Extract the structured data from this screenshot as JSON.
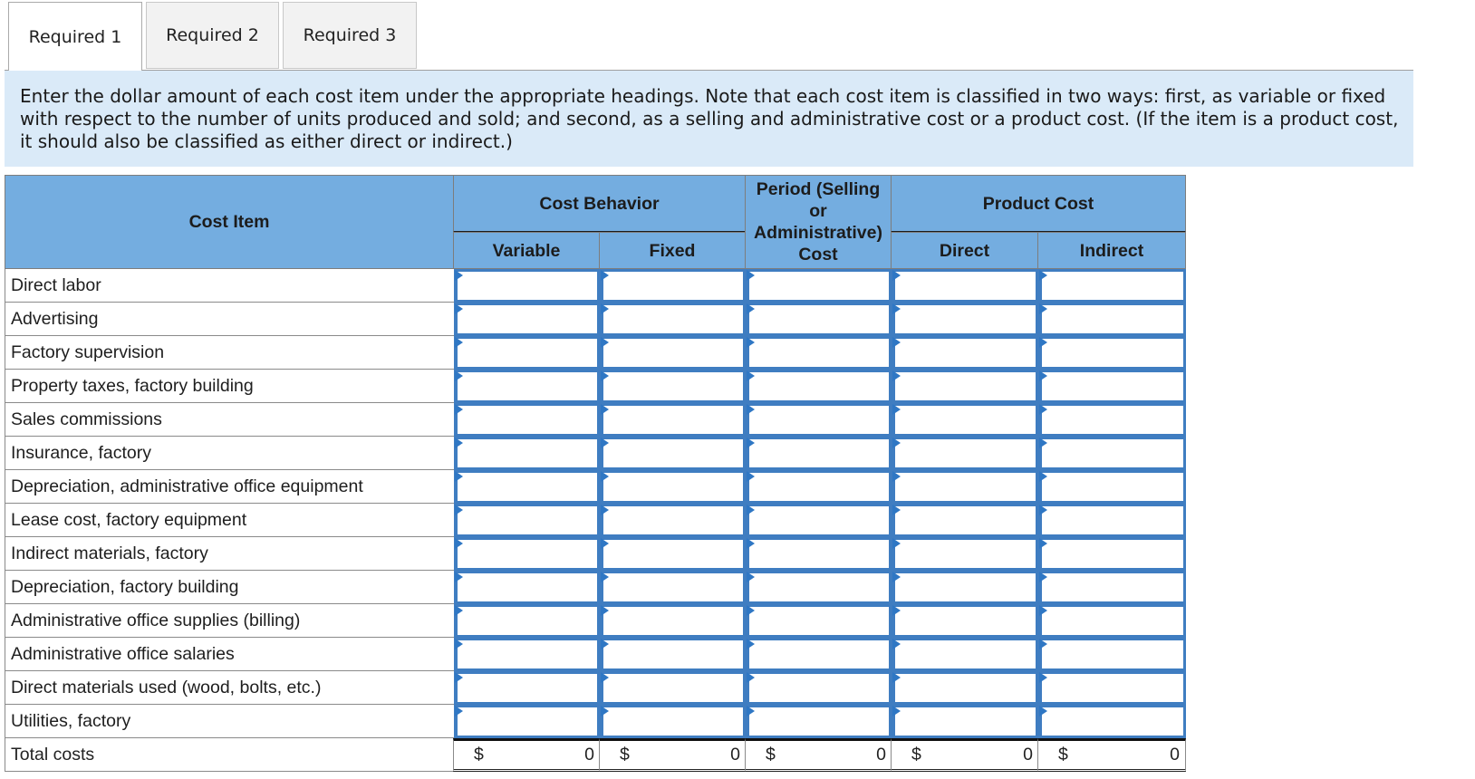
{
  "tabs": [
    {
      "label": "Required 1",
      "active": true
    },
    {
      "label": "Required 2",
      "active": false
    },
    {
      "label": "Required 3",
      "active": false
    }
  ],
  "instructions": "Enter the dollar amount of each cost item under the appropriate headings. Note that each cost item is classified in two ways: first, as variable or fixed with respect to the number of units produced and sold; and second, as a selling and administrative cost or a product cost. (If the item is a product cost, it should also be classified as either direct or indirect.)",
  "table": {
    "headers": {
      "cost_item": "Cost Item",
      "cost_behavior": "Cost Behavior",
      "variable": "Variable",
      "fixed": "Fixed",
      "period_cost": "Period (Selling or Administrative) Cost",
      "period_cost_lines": [
        "Period (Selling",
        "or",
        "Administrative)",
        "Cost"
      ],
      "product_cost": "Product Cost",
      "direct": "Direct",
      "indirect": "Indirect"
    },
    "rows": [
      {
        "label": "Direct labor",
        "values": [
          "",
          "",
          "",
          "",
          ""
        ]
      },
      {
        "label": "Advertising",
        "values": [
          "",
          "",
          "",
          "",
          ""
        ]
      },
      {
        "label": "Factory supervision",
        "values": [
          "",
          "",
          "",
          "",
          ""
        ]
      },
      {
        "label": "Property taxes, factory building",
        "values": [
          "",
          "",
          "",
          "",
          ""
        ]
      },
      {
        "label": "Sales commissions",
        "values": [
          "",
          "",
          "",
          "",
          ""
        ]
      },
      {
        "label": "Insurance, factory",
        "values": [
          "",
          "",
          "",
          "",
          ""
        ]
      },
      {
        "label": "Depreciation, administrative office equipment",
        "values": [
          "",
          "",
          "",
          "",
          ""
        ]
      },
      {
        "label": "Lease cost, factory equipment",
        "values": [
          "",
          "",
          "",
          "",
          ""
        ]
      },
      {
        "label": "Indirect materials, factory",
        "values": [
          "",
          "",
          "",
          "",
          ""
        ]
      },
      {
        "label": "Depreciation, factory building",
        "values": [
          "",
          "",
          "",
          "",
          ""
        ]
      },
      {
        "label": "Administrative office supplies (billing)",
        "values": [
          "",
          "",
          "",
          "",
          ""
        ]
      },
      {
        "label": "Administrative office salaries",
        "values": [
          "",
          "",
          "",
          "",
          ""
        ]
      },
      {
        "label": "Direct materials used (wood, bolts, etc.)",
        "values": [
          "",
          "",
          "",
          "",
          ""
        ]
      },
      {
        "label": "Utilities, factory",
        "values": [
          "",
          "",
          "",
          "",
          ""
        ]
      }
    ],
    "totals": {
      "label": "Total costs",
      "currency": "$",
      "values": [
        "0",
        "0",
        "0",
        "0",
        "0"
      ]
    }
  },
  "colors": {
    "header_bg": "#74ade0",
    "info_bg": "#daeaf8",
    "input_border": "#3f7dc1"
  }
}
